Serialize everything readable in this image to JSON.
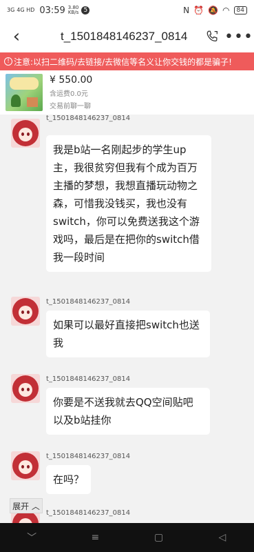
{
  "status_bar": {
    "signal_1": "3G",
    "signal_2": "4G HD",
    "time": "03:59",
    "speed_value": "3.80",
    "speed_unit": "KB/s",
    "notification_badge": "5",
    "battery": "84"
  },
  "header": {
    "back_symbol": "‹",
    "title": "t_1501848146237_0814",
    "more_symbol": "•••"
  },
  "warning": {
    "icon": "!",
    "text": "注意:以扫二维码/去链接/去微信等名义让你交钱的都是骗子!"
  },
  "product": {
    "price": "¥ 550.00",
    "shipping": "含运费0.0元",
    "trade_status": "交易前聊一聊"
  },
  "chat": {
    "messages": [
      {
        "sender": "t_1501848146237_0814",
        "text": "我是b站一名刚起步的学生up主，我很贫穷但我有个成为百万主播的梦想，我想直播玩动物之森，可惜我没钱买，我也没有switch，你可以免费送我这个游戏吗，最后是在把你的switch借我一段时间"
      },
      {
        "sender": "t_1501848146237_0814",
        "text": "如果可以最好直接把switch也送我"
      },
      {
        "sender": "t_1501848146237_0814",
        "text": "你要是不送我就去QQ空间贴吧以及b站挂你"
      },
      {
        "sender": "t_1501848146237_0814",
        "text": "在吗？"
      },
      {
        "sender": "t_1501848146237_0814",
        "text": ""
      }
    ],
    "expand_label": "展开 ︿"
  },
  "nav_bar": {
    "back": "﹀",
    "menu": "≡",
    "home": "▢",
    "recent": "◁"
  },
  "colors": {
    "warning_bg": "#ef5b5b",
    "chat_bg": "#f2f2f2",
    "nav_bg": "#111111"
  }
}
